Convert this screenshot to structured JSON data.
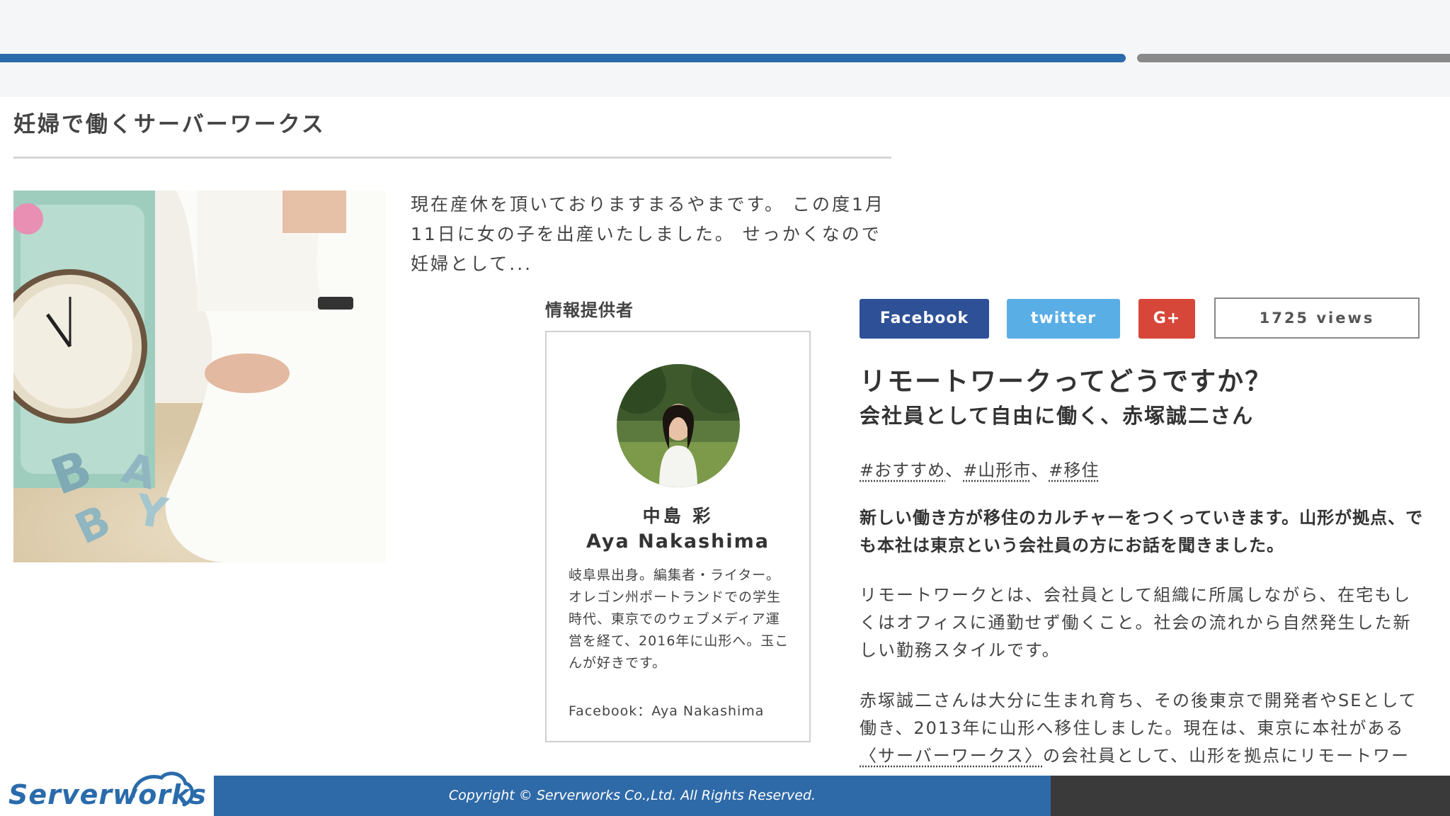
{
  "section": {
    "title": "妊婦で働くサーバーワークス"
  },
  "excerpt": {
    "text": "現在産休を頂いておりますまるやまです。 この度1月11日に女の子を出産いたしました。 せっかくなので妊婦として..."
  },
  "provider": {
    "label": "情報提供者",
    "name_jp": "中島 彩",
    "name_en": "Aya Nakashima",
    "bio": "岐阜県出身。編集者・ライター。オレゴン州ポートランドでの学生時代、東京でのウェブメディア運営を経て、2016年に山形へ。玉こんが好きです。",
    "facebook": "Facebook：Aya Nakashima"
  },
  "share": {
    "facebook_label": "Facebook",
    "twitter_label": "twitter",
    "gplus_label": "G+",
    "views": "1725  views"
  },
  "article": {
    "title": "リモートワークってどうですか？",
    "subtitle": "会社員として自由に働く、赤塚誠二さん",
    "tags": [
      "#おすすめ",
      "#山形市",
      "#移住"
    ],
    "tag_separator": "、",
    "lead": "新しい働き方が移住のカルチャーをつくっていきます。山形が拠点、でも本社は東京という会社員の方にお話を聞きました。",
    "para1": "リモートワークとは、会社員として組織に所属しながら、在宅もしくはオフィスに通勤せず働くこと。社会の流れから自然発生した新しい勤務スタイルです。",
    "para2_before": "赤塚誠二さんは大分に生まれ育ち、その後東京で開発者やSEとして働き、2013年に山形へ移住しました。現在は、東京に本社がある",
    "para2_link": "〈サーバーワークス〉",
    "para2_after": "の会社員として、山形を拠点にリモートワー"
  },
  "footer": {
    "logo": "Serverworks",
    "copyright": "Copyright ©  Serverworks Co.,Ltd. All Rights Reserved."
  },
  "colors": {
    "brand_blue": "#2f6aa8",
    "facebook": "#2e5096",
    "twitter": "#5aaee6",
    "gplus": "#d6473a"
  }
}
